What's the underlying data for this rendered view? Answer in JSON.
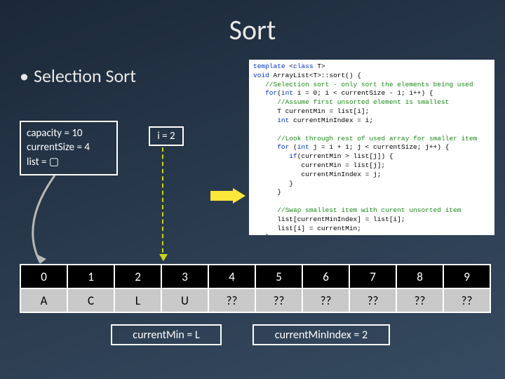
{
  "title": "Sort",
  "bullet": "Selection Sort",
  "state": {
    "capacity": "capacity = 10",
    "currentSize": "currentSize = 4",
    "list": "list = ▢"
  },
  "iBox": "i = 2",
  "code": {
    "l1a": "template",
    "l1b": " <",
    "l1c": "class",
    "l1d": " T>",
    "l2a": "void",
    "l2b": " ArrayList<T>::sort() {",
    "l3": "   //Selection sort - only sort the elements being used",
    "l4a": "   for",
    "l4b": "(",
    "l4c": "int",
    "l4d": " i = 0; i < currentSize - 1; i++) {",
    "l5": "      //Assume first unsorted element is smallest",
    "l6": "      T currentMin = list[i];",
    "l7a": "      int",
    "l7b": " currentMinIndex = i;",
    "l8": "",
    "l9": "      //Look through rest of used array for smaller item",
    "l10a": "      for",
    "l10b": " (",
    "l10c": "int",
    "l10d": " j = i + 1; j < currentSize; j++) {",
    "l11a": "         if",
    "l11b": "(currentMin > list[j]) {",
    "l12": "            currentMin = list[j];",
    "l13": "            currentMinIndex = j;",
    "l14": "         }",
    "l15": "      }",
    "l16": "",
    "l17": "      //Swap smallest item with curent unsorted item",
    "l18": "      list[currentMinIndex] = list[i];",
    "l19": "      list[i] = currentMin;",
    "l20": "   }",
    "l21": "}"
  },
  "array": {
    "indices": [
      "0",
      "1",
      "2",
      "3",
      "4",
      "5",
      "6",
      "7",
      "8",
      "9"
    ],
    "values": [
      "A",
      "C",
      "L",
      "U",
      "??",
      "??",
      "??",
      "??",
      "??",
      "??"
    ]
  },
  "bottomLeft": "currentMin = L",
  "bottomRight": "currentMinIndex = 2"
}
